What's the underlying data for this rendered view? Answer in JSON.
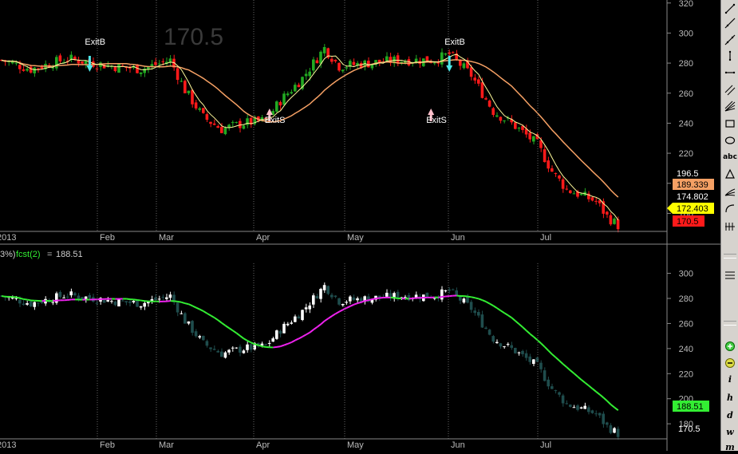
{
  "panel1": {
    "watermark": "170.5",
    "price_axis_ticks": [
      "320",
      "300",
      "280",
      "260",
      "240",
      "220",
      "200",
      "180"
    ],
    "labels": {
      "plain_value": "196.5",
      "orange_value": "189.339",
      "white_value": "174.802",
      "yellow_value": "172.403",
      "red_value": "170.5"
    },
    "signals": [
      {
        "text": "ExitB",
        "date_index": 24
      },
      {
        "text": "ExitS",
        "date_index": 73
      },
      {
        "text": "ExitS",
        "date_index": 117
      },
      {
        "text": "ExitB",
        "date_index": 122
      }
    ],
    "month_labels": [
      "2013",
      "Feb",
      "Mar",
      "Apr",
      "May",
      "Jun",
      "Jul"
    ]
  },
  "panel2": {
    "header_prefix": "3%)",
    "header_formula": "fcst(2)",
    "header_eq": "=",
    "header_value": "188.51",
    "price_axis_ticks": [
      "300",
      "280",
      "260",
      "240",
      "220",
      "200",
      "180"
    ],
    "labels": {
      "green_value": "188.51",
      "close_value": "170.5"
    },
    "month_labels": [
      "2013",
      "Feb",
      "Mar",
      "Apr",
      "May",
      "Jun",
      "Jul"
    ]
  },
  "colors": {
    "background": "#000000",
    "up_candle": "#22aa22",
    "down_candle": "#ff1a1a",
    "ma_fast": "#fffa9a",
    "ma_slow": "#f5a064",
    "forecast_up": "#33ee33",
    "forecast_down": "#ee22ee",
    "candle2_up": "#ffffff",
    "candle2_down": "#1f4d4d",
    "grid": "#666666",
    "label_orange": "#f5a064",
    "label_yellow": "#ffff00",
    "label_red": "#ff1a1a",
    "label_green": "#33ee33",
    "toolbar_bg": "#d6d3ce"
  },
  "toolbar": {
    "tools": [
      {
        "name": "line-icon",
        "glyph": "line"
      },
      {
        "name": "ray-icon",
        "glyph": "ray"
      },
      {
        "name": "extended-line-icon",
        "glyph": "ext"
      },
      {
        "name": "vertical-line-icon",
        "glyph": "vline"
      },
      {
        "name": "horizontal-line-icon",
        "glyph": "hline"
      },
      {
        "name": "parallel-lines-icon",
        "glyph": "para"
      },
      {
        "name": "fibonacci-fan-icon",
        "glyph": "fan"
      },
      {
        "name": "rectangle-icon",
        "glyph": "rect"
      },
      {
        "name": "ellipse-icon",
        "glyph": "ellipse"
      },
      {
        "name": "text-tool-icon",
        "glyph": "abc"
      },
      {
        "name": "triangle-icon",
        "glyph": "tri"
      },
      {
        "name": "gann-fan-icon",
        "glyph": "gann"
      },
      {
        "name": "arc-icon",
        "glyph": "arc"
      },
      {
        "name": "cycle-lines-icon",
        "glyph": "cycle"
      }
    ],
    "tools_lower": [
      {
        "name": "sep-icon",
        "glyph": "sep"
      },
      {
        "name": "grid-icon",
        "glyph": "grid"
      },
      {
        "name": "sep2-icon",
        "glyph": "sep"
      },
      {
        "name": "zoom-in-icon",
        "glyph": "zoomin"
      },
      {
        "name": "zoom-out-icon",
        "glyph": "zoomout"
      }
    ],
    "intervals": [
      "i",
      "h",
      "d",
      "w",
      "m"
    ]
  }
}
